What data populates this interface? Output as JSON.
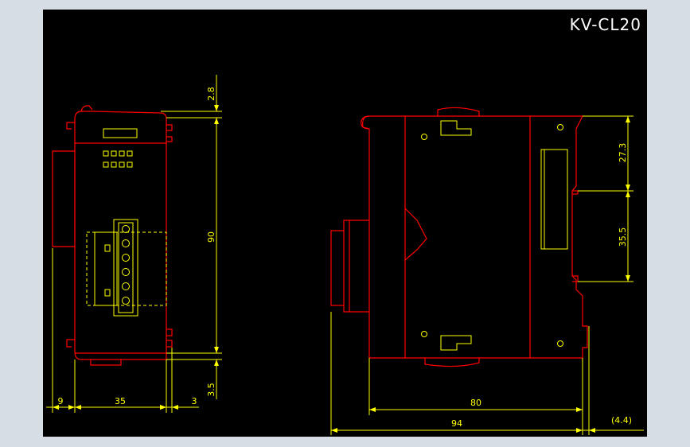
{
  "drawing": {
    "title": "KV-CL20",
    "colors": {
      "background": "#000000",
      "outline": "#ff0000",
      "dimension": "#ffff00",
      "label": "#ffffff",
      "border": "#d6dde4"
    }
  },
  "side_view": {
    "dimensions": {
      "top_offset": "2.8",
      "height": "90",
      "bottom_offset": "3.5",
      "left_offset": "9",
      "width": "35",
      "right_offset": "3"
    }
  },
  "front_view": {
    "dimensions": {
      "upper_rail": "27.3",
      "rail_width": "35.5",
      "depth": "80",
      "total_depth": "94",
      "rail_offset": "(4.4)"
    }
  }
}
